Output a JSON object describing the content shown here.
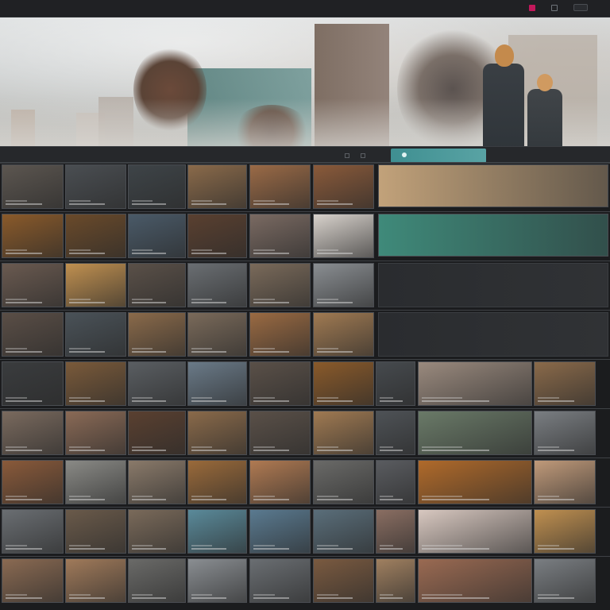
{
  "topbar": {
    "nav_items": [
      "",
      "",
      "",
      "",
      "",
      "",
      ""
    ],
    "right_items": [
      "",
      "",
      ""
    ]
  },
  "toolbar": {
    "tabs": [
      "",
      "",
      "",
      "",
      ""
    ],
    "pill_label": ""
  },
  "colors": {
    "accent_teal": "#4a9a9b",
    "badge_pink": "#c2185b",
    "background": "#1b1c1e"
  },
  "icons": {
    "top_badge": "notification-badge-icon",
    "top_button": "window-icon",
    "toolbar_pill": "layers-icon"
  },
  "grid": {
    "rows": [
      {
        "thumbs": [
          "#5c5650",
          "#4a4e52",
          "#3e4448",
          "#8a6a4a",
          "#9a6a46",
          "#8a5a3a"
        ],
        "banner": "#c2a27a"
      },
      {
        "thumbs": [
          "#8a5a2a",
          "#6a4a2a",
          "#4a5a68",
          "#5a4030",
          "#7a6a62",
          "#d8d2cc"
        ],
        "banner": "#3f8a7a"
      },
      {
        "thumbs": [
          "#6a5a50",
          "#c09050",
          "#5a5048",
          "#6a6e72",
          "#7a6a5a",
          "#8a8e92"
        ]
      },
      {
        "thumbs": [
          "#5a4e46",
          "#4a5258",
          "#8a6a4a",
          "#7a6a5a",
          "#9a6a42",
          "#a07a52"
        ]
      },
      {
        "thumbs": [
          "#3a3c3e",
          "#7a5a3a",
          "#5a5e62",
          "#6a7a88",
          "#5a5048",
          "#8a5a2a",
          "#464a4e",
          "#9a8a7e",
          "#8a6a4a"
        ]
      },
      {
        "thumbs": [
          "#7a6a5e",
          "#8a6a56",
          "#5a4030",
          "#8a6a4a",
          "#5a5048",
          "#a07a52",
          "#4e5256",
          "#6a7a68",
          "#7a7e82"
        ]
      },
      {
        "thumbs": [
          "#8a5a3a",
          "#8a8a86",
          "#8a7a6a",
          "#9a6a3a",
          "#b07a52",
          "#6a6a68",
          "#5a5c60",
          "#b06a2a",
          "#c09a7a"
        ]
      },
      {
        "thumbs": [
          "#6a6e72",
          "#6a5a4a",
          "#7a6a5a",
          "#5a8a9a",
          "#5a7a90",
          "#5a6e7a",
          "#8a6e62",
          "#d8c8c0",
          "#c09050"
        ]
      },
      {
        "thumbs": [
          "#8a6a52",
          "#a07a5a",
          "#6a6a68",
          "#8a8e92",
          "#6a6e72",
          "#7a5a40",
          "#a08060",
          "#9a6a52",
          "#7a7e82"
        ]
      }
    ]
  }
}
